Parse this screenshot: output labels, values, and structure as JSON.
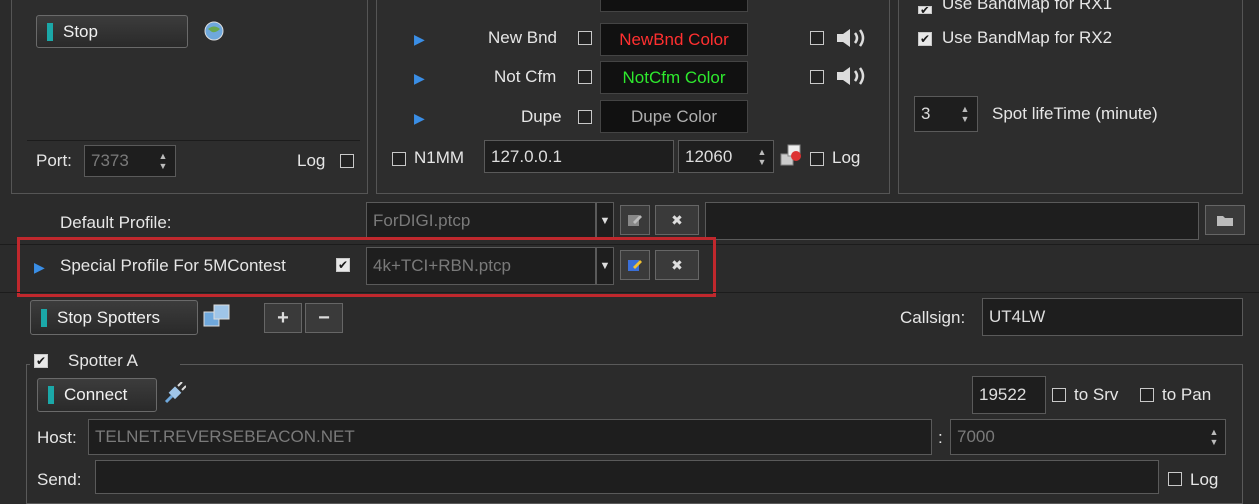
{
  "top_left": {
    "stop_label": "Stop",
    "port_label": "Port:",
    "port_value": "7373",
    "log_label": "Log"
  },
  "alerts": {
    "rows": [
      {
        "label": "New Bnd",
        "color_label": "NewBnd Color",
        "color": "#ff3030"
      },
      {
        "label": "Not Cfm",
        "color_label": "NotCfm Color",
        "color": "#2ee82e"
      },
      {
        "label": "Dupe",
        "color_label": "Dupe Color",
        "color": "#b0b0b0"
      }
    ],
    "n1mm_label": "N1MM",
    "n1mm_ip": "127.0.0.1",
    "n1mm_port": "12060",
    "log_label": "Log"
  },
  "bandmap": {
    "rx1_label": "Use BandMap for RX1",
    "rx2_label": "Use BandMap for RX2",
    "lifetime_value": "3",
    "lifetime_label": "Spot lifeTime (minute)"
  },
  "profiles": {
    "default_label": "Default Profile:",
    "default_value": "ForDIGI.ptcp",
    "special_label": "Special Profile For 5MContest",
    "special_value": "4k+TCI+RBN.ptcp"
  },
  "spotters": {
    "stop_label": "Stop Spotters",
    "callsign_label": "Callsign:",
    "callsign_value": "UT4LW"
  },
  "spotter_a": {
    "title": "Spotter A",
    "connect_label": "Connect",
    "port_value": "19522",
    "to_srv_label": "to Srv",
    "to_pan_label": "to Pan",
    "host_label": "Host:",
    "host_value": "TELNET.REVERSEBEACON.NET",
    "colon": ":",
    "host_port": "7000",
    "send_label": "Send:",
    "log_label": "Log"
  },
  "colors": {
    "highlight_border": "#c0282d",
    "accent_bar": "#1ba8a8",
    "arrow": "#3a8ee6"
  }
}
